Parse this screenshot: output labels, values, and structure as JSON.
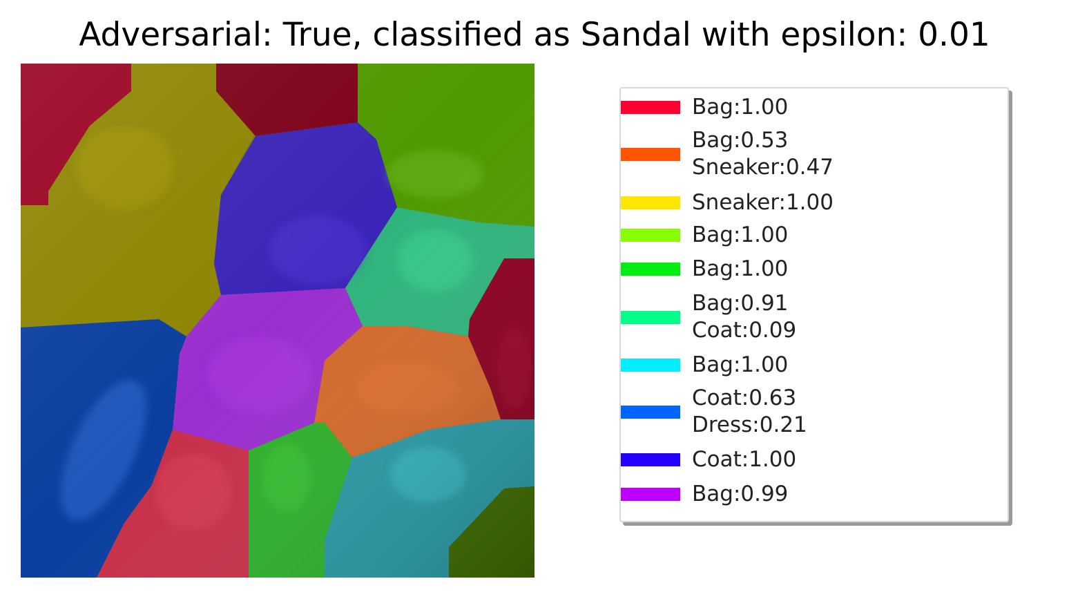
{
  "title": "Adversarial: True, classified as Sandal with epsilon: 0.01",
  "segments": [
    {
      "name": "red-top-left",
      "color": "#9a0020"
    },
    {
      "name": "olive",
      "color": "#8d8500"
    },
    {
      "name": "dark-red-top",
      "color": "#7d0018"
    },
    {
      "name": "green-top-right",
      "color": "#4f9a00"
    },
    {
      "name": "indigo",
      "color": "#3b25b8"
    },
    {
      "name": "teal-green",
      "color": "#2fb47c"
    },
    {
      "name": "crimson-right",
      "color": "#8c0020"
    },
    {
      "name": "purple",
      "color": "#9b2fd0"
    },
    {
      "name": "blue-left",
      "color": "#0a3fa0"
    },
    {
      "name": "orange",
      "color": "#d4692c"
    },
    {
      "name": "pink-red",
      "color": "#c8304a"
    },
    {
      "name": "green-bottom",
      "color": "#2fb02c"
    },
    {
      "name": "cyan-teal",
      "color": "#2a9aa6"
    },
    {
      "name": "dark-green-bottom-right",
      "color": "#3e6a00"
    }
  ],
  "legend": {
    "entries": [
      {
        "text": "Bag:1.00",
        "color": "#ff0033"
      },
      {
        "text": "Bag:0.53\nSneaker:0.47",
        "color": "#ff5500"
      },
      {
        "text": "Sneaker:1.00",
        "color": "#ffe600"
      },
      {
        "text": "Bag:1.00",
        "color": "#88ff00"
      },
      {
        "text": "Bag:1.00",
        "color": "#00ee11"
      },
      {
        "text": "Bag:0.91\nCoat:0.09",
        "color": "#00ff88"
      },
      {
        "text": "Bag:1.00",
        "color": "#00eeff"
      },
      {
        "text": "Coat:0.63\nDress:0.21",
        "color": "#0066ff"
      },
      {
        "text": "Coat:1.00",
        "color": "#2200ff"
      },
      {
        "text": "Bag:0.99",
        "color": "#bb00ff"
      }
    ]
  }
}
